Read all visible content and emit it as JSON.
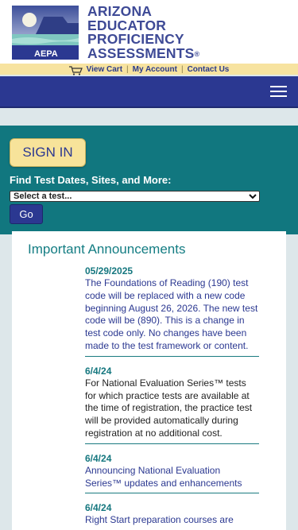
{
  "header": {
    "logo_text": "AEPA",
    "title_lines": [
      "ARIZONA",
      "EDUCATOR",
      "PROFICIENCY",
      "ASSESSMENTS"
    ],
    "registered_mark": "®"
  },
  "utility": {
    "view_cart": "View Cart",
    "my_account": "My Account",
    "contact_us": "Contact Us",
    "separator": "|"
  },
  "search": {
    "signin_label": "SIGN IN",
    "find_label": "Find Test Dates, Sites, and More:",
    "select_value": "Select a test...",
    "go_label": "Go"
  },
  "announcements": {
    "title": "Important Announcements",
    "items": [
      {
        "date": "05/29/2025",
        "text": "The Foundations of Reading (190) test code will be replaced with a new code beginning August 26, 2026. The new test code will be (890). This is a change in test code only. No changes have been made to the test framework or content."
      },
      {
        "date": "6/4/24",
        "text": "For National Evaluation Series™ tests for which practice tests are available at the time of registration, the practice test will be provided automatically during registration at no additional cost."
      },
      {
        "date": "6/4/24",
        "text": "Announcing National Evaluation Series™ updates and enhancements"
      },
      {
        "date": "6/4/24",
        "text": "Right Start preparation courses are"
      }
    ]
  },
  "colors": {
    "navy": "#2b3891",
    "teal": "#11777f",
    "gold": "#f7e39a",
    "page_bg": "#dde7ea"
  }
}
